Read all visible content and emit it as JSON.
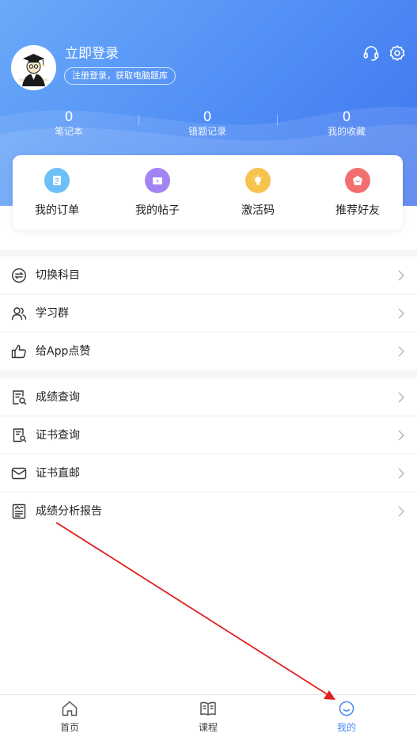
{
  "header": {
    "login_title": "立即登录",
    "login_pill": "注册登录，获取电脑题库",
    "icons": {
      "support": "headset-icon",
      "settings": "gear-icon"
    },
    "stats": [
      {
        "num": "0",
        "label": "笔记本"
      },
      {
        "num": "0",
        "label": "错题记录"
      },
      {
        "num": "0",
        "label": "我的收藏"
      }
    ]
  },
  "quick": [
    {
      "label": "我的订单",
      "icon": "order-icon",
      "color": "#5fb6f5"
    },
    {
      "label": "我的帖子",
      "icon": "post-icon",
      "color": "#9b7cf2"
    },
    {
      "label": "激活码",
      "icon": "activation-icon",
      "color": "#f6c24a"
    },
    {
      "label": "推荐好友",
      "icon": "recommend-icon",
      "color": "#f16a6a"
    }
  ],
  "menu": [
    {
      "label": "切换科目",
      "icon": "switch-icon"
    },
    {
      "label": "学习群",
      "icon": "group-icon"
    },
    {
      "label": "给App点赞",
      "icon": "thumbs-up-icon"
    },
    {
      "label": "成绩查询",
      "icon": "score-query-icon"
    },
    {
      "label": "证书查询",
      "icon": "certificate-query-icon"
    },
    {
      "label": "证书直邮",
      "icon": "mail-icon"
    },
    {
      "label": "成绩分析报告",
      "icon": "report-icon"
    }
  ],
  "tabs": [
    {
      "label": "首页",
      "icon": "home-icon"
    },
    {
      "label": "课程",
      "icon": "course-book-icon"
    },
    {
      "label": "我的",
      "icon": "profile-smile-icon",
      "active": true
    }
  ],
  "colors": {
    "accent": "#4d8cf5",
    "annotation_arrow": "#e02020"
  }
}
